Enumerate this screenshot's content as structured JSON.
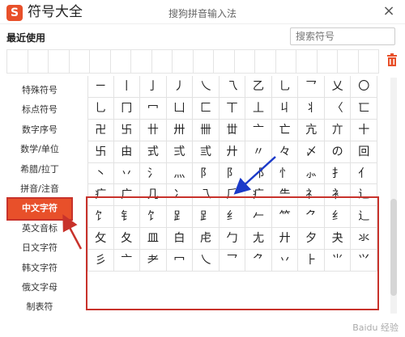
{
  "window": {
    "app_title": "符号大全",
    "center_title": "搜狗拼音输入法",
    "close_glyph": "×"
  },
  "recent": {
    "label": "最近使用",
    "cells": 18
  },
  "search": {
    "placeholder": "搜索符号"
  },
  "sidebar": {
    "items": [
      {
        "label": "特殊符号",
        "active": false
      },
      {
        "label": "标点符号",
        "active": false
      },
      {
        "label": "数字序号",
        "active": false
      },
      {
        "label": "数学/单位",
        "active": false
      },
      {
        "label": "希腊/拉丁",
        "active": false
      },
      {
        "label": "拼音/注音",
        "active": false
      },
      {
        "label": "中文字符",
        "active": true
      },
      {
        "label": "英文音标",
        "active": false
      },
      {
        "label": "日文字符",
        "active": false
      },
      {
        "label": "韩文字符",
        "active": false
      },
      {
        "label": "俄文字母",
        "active": false
      },
      {
        "label": "制表符",
        "active": false
      }
    ]
  },
  "grid": {
    "rows": [
      [
        "ㄧ",
        "丨",
        "亅",
        "丿",
        "乀",
        "乁",
        "乙",
        "乚",
        "乛",
        "乂",
        "〇"
      ],
      [
        "乚",
        "冂",
        "冖",
        "凵",
        "匚",
        "丅",
        "丄",
        "丩",
        "丬",
        "〈",
        "匸"
      ],
      [
        "卍",
        "卐",
        "卄",
        "卅",
        "卌",
        "丗",
        "亠",
        "亡",
        "亢",
        "亣",
        "十"
      ],
      [
        "卐",
        "由",
        "式",
        "弍",
        "弎",
        "廾",
        "〃",
        "々",
        "〆",
        "の",
        "回"
      ],
      [
        "丶",
        "丷",
        "氵",
        "灬",
        "阝",
        "⻖",
        "⻏",
        "忄",
        "⺗",
        "扌",
        "亻"
      ],
      [
        "疒",
        "广",
        "几",
        "冫",
        "乁",
        "⺁",
        "疒",
        "⺧",
        "礻",
        "衤",
        "辶"
      ],
      [
        "饣",
        "钅",
        "饣",
        "⻊",
        "⻊",
        "纟",
        "𠂉",
        "⺮",
        "⺈",
        "纟",
        "辶"
      ],
      [
        "攵",
        "夂",
        "皿",
        "白",
        "虍",
        "勹",
        "尢",
        "廾",
        "夕",
        "夬",
        "氺",
        "丆"
      ],
      [
        "彡",
        "亠",
        "耂",
        "冖",
        "乀",
        "乛",
        "⺈",
        "丷",
        "⺊",
        "⺌",
        "⺍"
      ]
    ]
  },
  "watermark": "Baidu 经验"
}
